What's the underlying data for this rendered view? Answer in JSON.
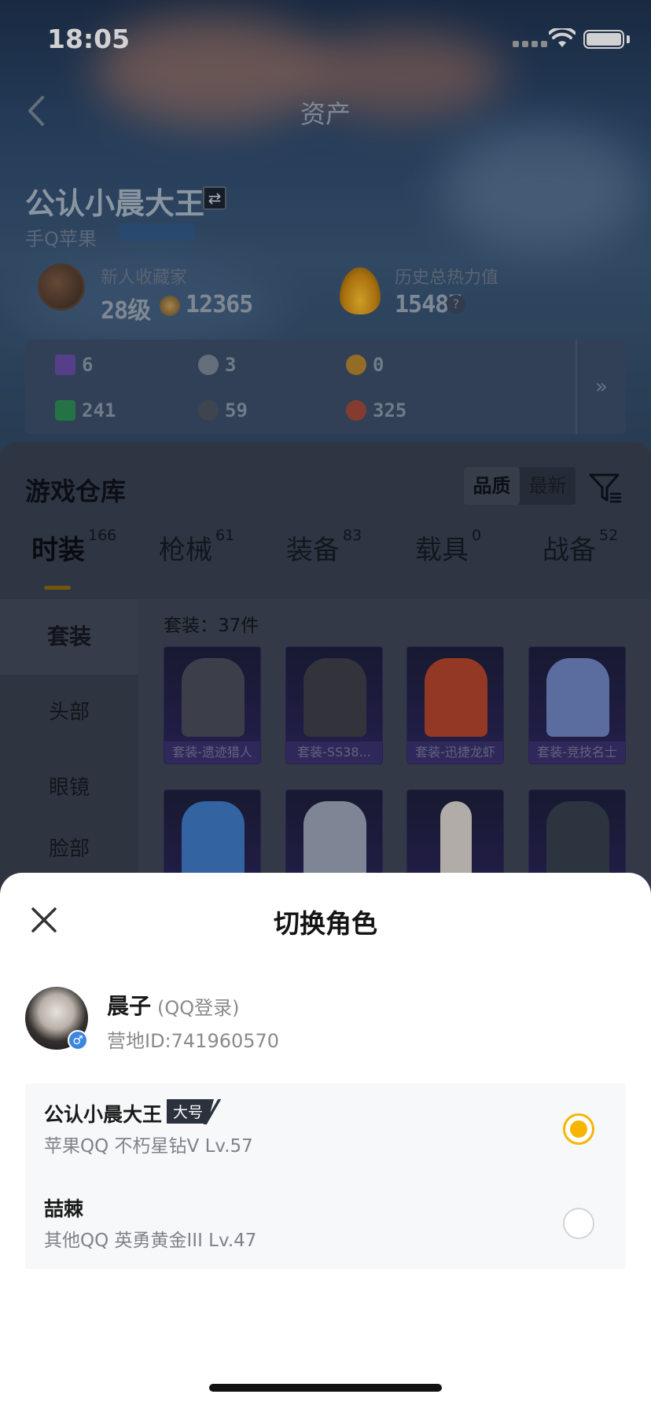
{
  "status_bar": {
    "time": "18:05"
  },
  "nav": {
    "title": "资产"
  },
  "player": {
    "name": "公认小晨大王",
    "platform": "手Q苹果"
  },
  "stats": {
    "rank_title": "新人收藏家",
    "level": "28级",
    "coins": "12365",
    "heat_label": "历史总热力值",
    "heat_value": "15487",
    "help": "?"
  },
  "resources": {
    "items": [
      {
        "icon": "purple-card-icon",
        "value": "6",
        "color": "#6a4ea8"
      },
      {
        "icon": "silver-token-icon",
        "value": "3",
        "color": "#7b8896"
      },
      {
        "icon": "gold-token-icon",
        "value": "0",
        "color": "#b4862e"
      },
      {
        "icon": "green-card-icon",
        "value": "241",
        "color": "#2f8c57"
      },
      {
        "icon": "dark-orb-icon",
        "value": "59",
        "color": "#4c5560"
      },
      {
        "icon": "red-orb-icon",
        "value": "325",
        "color": "#a34a3a"
      }
    ],
    "more": "»"
  },
  "warehouse": {
    "title": "游戏仓库",
    "sort": {
      "quality": "品质",
      "newest": "最新"
    },
    "tabs": [
      {
        "label": "时装",
        "count": "166"
      },
      {
        "label": "枪械",
        "count": "61"
      },
      {
        "label": "装备",
        "count": "83"
      },
      {
        "label": "载具",
        "count": "0"
      },
      {
        "label": "战备",
        "count": "52"
      }
    ],
    "side_menu": [
      "套装",
      "头部",
      "眼镜",
      "脸部"
    ],
    "suit_count": "套装：37件",
    "cards": [
      {
        "label": "套装-遗迹猎人",
        "color": "#4a4d5a"
      },
      {
        "label": "套装-SS38...",
        "color": "#3d3f48"
      },
      {
        "label": "套装-迅捷龙虾",
        "color": "#b4452c"
      },
      {
        "label": "套装-竞技名士",
        "color": "#6f86c2"
      },
      {
        "label": "",
        "color": "#3f79c4"
      },
      {
        "label": "",
        "color": "#9aa4b8"
      },
      {
        "label": "",
        "color": "#d8d2cc"
      },
      {
        "label": "",
        "color": "#36404e"
      }
    ]
  },
  "sheet": {
    "title": "切换角色",
    "account": {
      "name": "晨子",
      "login": "(QQ登录)",
      "id": "营地ID:741960570",
      "gender": "♂"
    },
    "roles": [
      {
        "name": "公认小晨大王",
        "badge": "大号",
        "meta": "苹果QQ   不朽星钻V   Lv.57",
        "selected": true
      },
      {
        "name": "喆棘",
        "badge": "",
        "meta": "其他QQ   英勇黄金III   Lv.47",
        "selected": false
      }
    ]
  }
}
